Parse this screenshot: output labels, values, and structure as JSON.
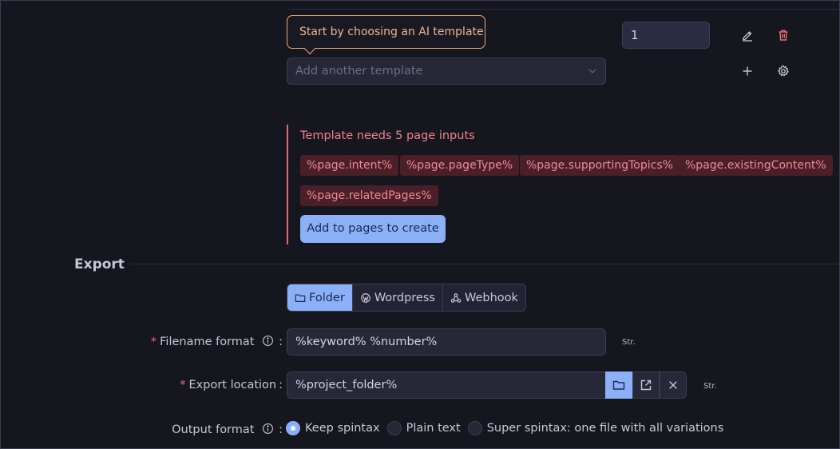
{
  "template": {
    "tooltip": "Start by choosing an AI template",
    "count_value": "1",
    "select_placeholder": "Add another template"
  },
  "warning": {
    "title": "Template needs 5 page inputs",
    "tags": [
      "%page.intent%",
      "%page.pageType%",
      "%page.supportingTopics%",
      "%page.existingContent%",
      "%page.relatedPages%"
    ],
    "button_label": "Add to pages to create"
  },
  "export": {
    "section_title": "Export",
    "tabs": [
      "Folder",
      "Wordpress",
      "Webhook"
    ],
    "active_tab": "Folder",
    "filename_label": "Filename format",
    "filename_value": "%keyword% %number%",
    "location_label": "Export location",
    "location_value": "%project_folder%",
    "str_label": "Str.",
    "output_label": "Output format",
    "output_options": [
      "Keep spintax",
      "Plain text",
      "Super spintax: one file with all variations"
    ],
    "output_selected": "Keep spintax"
  },
  "colors": {
    "accent": "#8cb0f7",
    "danger": "#ef6c7a",
    "warning_tooltip": "#e9a97a",
    "background": "#16161e"
  },
  "icons": [
    "pencil-icon",
    "trash-icon",
    "plus-icon",
    "gear-icon",
    "chevron-down-icon",
    "folder-icon",
    "wordpress-icon",
    "webhook-icon",
    "info-icon",
    "external-link-icon",
    "close-icon"
  ]
}
